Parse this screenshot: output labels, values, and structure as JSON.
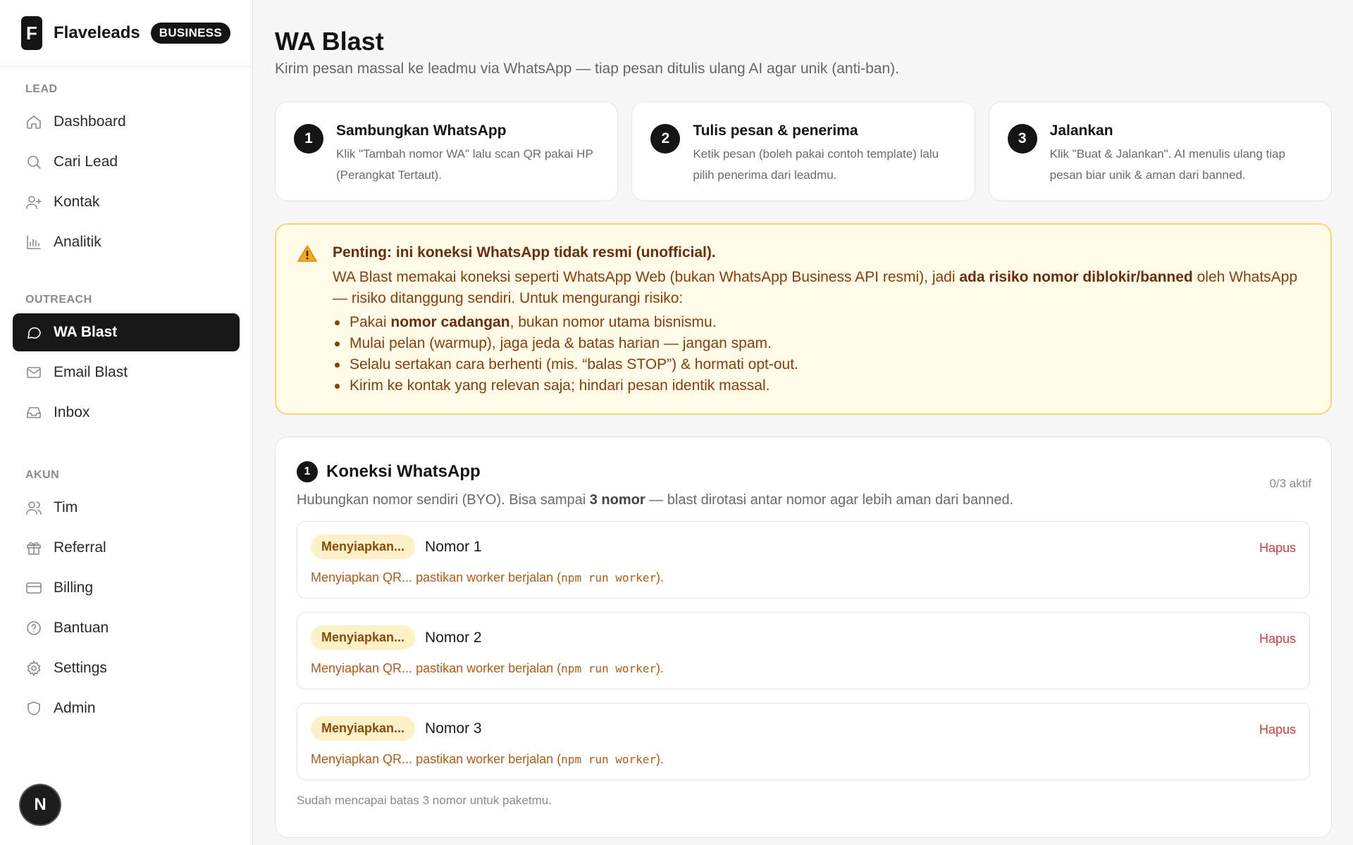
{
  "brand": {
    "logo_letter": "F",
    "name": "Flaveleads",
    "badge": "BUSINESS"
  },
  "sidebar": {
    "sections": [
      {
        "heading": "LEAD",
        "items": [
          {
            "label": "Dashboard",
            "icon": "home-icon"
          },
          {
            "label": "Cari Lead",
            "icon": "search-icon"
          },
          {
            "label": "Kontak",
            "icon": "user-plus-icon"
          },
          {
            "label": "Analitik",
            "icon": "bar-chart-icon"
          }
        ]
      },
      {
        "heading": "OUTREACH",
        "items": [
          {
            "label": "WA Blast",
            "icon": "chat-icon",
            "active": true
          },
          {
            "label": "Email Blast",
            "icon": "mail-icon"
          },
          {
            "label": "Inbox",
            "icon": "inbox-icon"
          }
        ]
      },
      {
        "heading": "AKUN",
        "items": [
          {
            "label": "Tim",
            "icon": "users-icon"
          },
          {
            "label": "Referral",
            "icon": "gift-icon"
          },
          {
            "label": "Billing",
            "icon": "credit-card-icon"
          },
          {
            "label": "Bantuan",
            "icon": "help-icon"
          },
          {
            "label": "Settings",
            "icon": "gear-icon"
          },
          {
            "label": "Admin",
            "icon": "shield-icon"
          }
        ]
      }
    ],
    "dev_badge": "N"
  },
  "page": {
    "title": "WA Blast",
    "subtitle": "Kirim pesan massal ke leadmu via WhatsApp — tiap pesan ditulis ulang AI agar unik (anti-ban)."
  },
  "steps": [
    {
      "num": "1",
      "title": "Sambungkan WhatsApp",
      "desc": "Klik \"Tambah nomor WA\" lalu scan QR pakai HP (Perangkat Tertaut)."
    },
    {
      "num": "2",
      "title": "Tulis pesan & penerima",
      "desc": "Ketik pesan (boleh pakai contoh template) lalu pilih penerima dari leadmu."
    },
    {
      "num": "3",
      "title": "Jalankan",
      "desc": "Klik \"Buat & Jalankan\". AI menulis ulang tiap pesan biar unik & aman dari banned."
    }
  ],
  "warning": {
    "title": "Penting: ini koneksi WhatsApp tidak resmi (unofficial).",
    "text_before": "WA Blast memakai koneksi seperti WhatsApp Web (bukan WhatsApp Business API resmi), jadi ",
    "text_bold": "ada risiko nomor diblokir/banned",
    "text_after": " oleh WhatsApp — risiko ditanggung sendiri. Untuk mengurangi risiko:",
    "bullets": [
      {
        "pre": "Pakai ",
        "bold": "nomor cadangan",
        "post": ", bukan nomor utama bisnismu."
      },
      {
        "pre": "Mulai pelan (warmup), jaga jeda & batas harian — jangan spam.",
        "bold": "",
        "post": ""
      },
      {
        "pre": "Selalu sertakan cara berhenti (mis. “balas STOP”) & hormati opt-out.",
        "bold": "",
        "post": ""
      },
      {
        "pre": "Kirim ke kontak yang relevan saja; hindari pesan identik massal.",
        "bold": "",
        "post": ""
      }
    ],
    "color_bg": "#fefbe8",
    "color_border": "#f3d872"
  },
  "connections": {
    "num": "1",
    "title": "Koneksi WhatsApp",
    "count": "0/3 aktif",
    "desc_before": "Hubungkan nomor sendiri (BYO). Bisa sampai ",
    "desc_bold": "3 nomor",
    "desc_after": " — blast dirotasi antar nomor agar lebih aman dari banned.",
    "items": [
      {
        "status": "Menyiapkan...",
        "name": "Nomor 1",
        "delete": "Hapus",
        "msg_before": "Menyiapkan QR... pastikan worker berjalan (",
        "msg_code": "npm run worker",
        "msg_after": ")."
      },
      {
        "status": "Menyiapkan...",
        "name": "Nomor 2",
        "delete": "Hapus",
        "msg_before": "Menyiapkan QR... pastikan worker berjalan (",
        "msg_code": "npm run worker",
        "msg_after": ")."
      },
      {
        "status": "Menyiapkan...",
        "name": "Nomor 3",
        "delete": "Hapus",
        "msg_before": "Menyiapkan QR... pastikan worker berjalan (",
        "msg_code": "npm run worker",
        "msg_after": ")."
      }
    ],
    "footer": "Sudah mencapai batas 3 nomor untuk paketmu."
  },
  "colors": {
    "accent": "#171717",
    "danger": "#d23a3a",
    "status_bg": "#fdf1c7"
  }
}
